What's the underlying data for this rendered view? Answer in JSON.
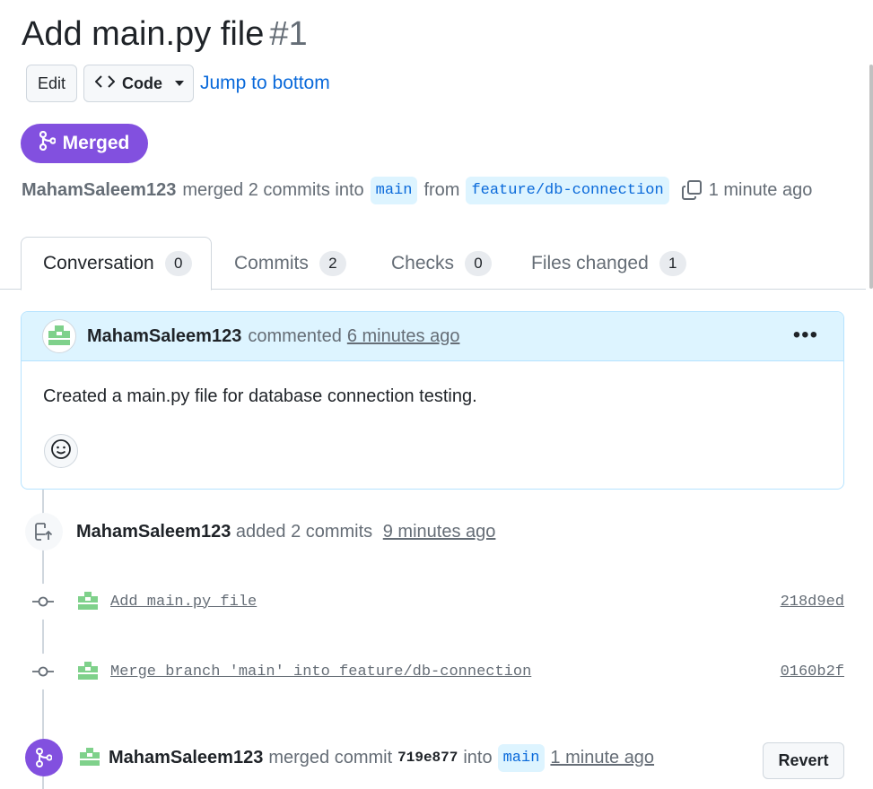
{
  "pr": {
    "title": "Add main.py file",
    "number": "#1",
    "state": "Merged",
    "author": "MahamSaleem123",
    "merged_text": "merged 2 commits into",
    "base_branch": "main",
    "from_text": "from",
    "head_branch": "feature/db-connection",
    "merged_time": "1 minute ago"
  },
  "actions": {
    "edit_label": "Edit",
    "code_label": "Code",
    "jump_label": "Jump to bottom"
  },
  "tabs": [
    {
      "label": "Conversation",
      "count": "0"
    },
    {
      "label": "Commits",
      "count": "2"
    },
    {
      "label": "Checks",
      "count": "0"
    },
    {
      "label": "Files changed",
      "count": "1"
    }
  ],
  "comment": {
    "author": "MahamSaleem123",
    "verb": "commented",
    "time": "6 minutes ago",
    "body": "Created a main.py file for database connection testing."
  },
  "timeline": {
    "push_event": {
      "author": "MahamSaleem123",
      "text": "added 2 commits",
      "time": "9 minutes ago"
    },
    "commits": [
      {
        "message": "Add main.py file",
        "sha": "218d9ed"
      },
      {
        "message": "Merge branch 'main' into feature/db-connection",
        "sha": "0160b2f"
      }
    ],
    "merge_event": {
      "author": "MahamSaleem123",
      "text": "merged commit",
      "sha": "719e877",
      "into_text": "into",
      "branch": "main",
      "time": "1 minute ago",
      "revert_label": "Revert"
    }
  },
  "colors": {
    "merged_purple": "#8250df",
    "link_blue": "#0969da",
    "branch_bg": "#ddf4ff"
  }
}
